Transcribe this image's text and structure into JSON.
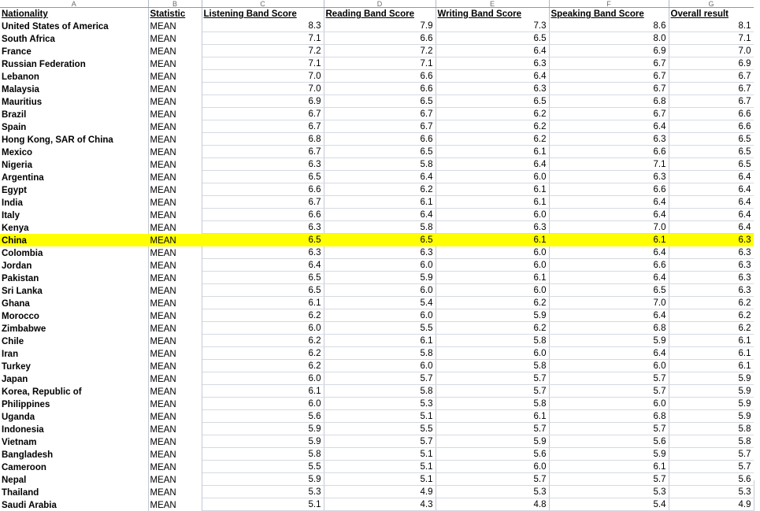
{
  "app": {
    "type": "spreadsheet",
    "highlight_color": "#ffff00",
    "grid_line_color": "#c3c9d3"
  },
  "column_letters": [
    "A",
    "B",
    "C",
    "D",
    "E",
    "F",
    "G"
  ],
  "table": {
    "headers": [
      "Nationality",
      "Statistic",
      "Listening Band Score",
      "Reading Band Score",
      "Writing Band Score",
      "Speaking Band Score",
      "Overall result"
    ],
    "highlighted_row_index": 17,
    "rows": [
      {
        "nationality": "United States of America",
        "statistic": "MEAN",
        "listening": "8.3",
        "reading": "7.9",
        "writing": "7.3",
        "speaking": "8.6",
        "overall": "8.1"
      },
      {
        "nationality": "South Africa",
        "statistic": "MEAN",
        "listening": "7.1",
        "reading": "6.6",
        "writing": "6.5",
        "speaking": "8.0",
        "overall": "7.1"
      },
      {
        "nationality": "France",
        "statistic": "MEAN",
        "listening": "7.2",
        "reading": "7.2",
        "writing": "6.4",
        "speaking": "6.9",
        "overall": "7.0"
      },
      {
        "nationality": "Russian Federation",
        "statistic": "MEAN",
        "listening": "7.1",
        "reading": "7.1",
        "writing": "6.3",
        "speaking": "6.7",
        "overall": "6.9"
      },
      {
        "nationality": "Lebanon",
        "statistic": "MEAN",
        "listening": "7.0",
        "reading": "6.6",
        "writing": "6.4",
        "speaking": "6.7",
        "overall": "6.7"
      },
      {
        "nationality": "Malaysia",
        "statistic": "MEAN",
        "listening": "7.0",
        "reading": "6.6",
        "writing": "6.3",
        "speaking": "6.7",
        "overall": "6.7"
      },
      {
        "nationality": "Mauritius",
        "statistic": "MEAN",
        "listening": "6.9",
        "reading": "6.5",
        "writing": "6.5",
        "speaking": "6.8",
        "overall": "6.7"
      },
      {
        "nationality": "Brazil",
        "statistic": "MEAN",
        "listening": "6.7",
        "reading": "6.7",
        "writing": "6.2",
        "speaking": "6.7",
        "overall": "6.6"
      },
      {
        "nationality": "Spain",
        "statistic": "MEAN",
        "listening": "6.7",
        "reading": "6.7",
        "writing": "6.2",
        "speaking": "6.4",
        "overall": "6.6"
      },
      {
        "nationality": "Hong Kong, SAR of China",
        "statistic": "MEAN",
        "listening": "6.8",
        "reading": "6.6",
        "writing": "6.2",
        "speaking": "6.3",
        "overall": "6.5"
      },
      {
        "nationality": "Mexico",
        "statistic": "MEAN",
        "listening": "6.7",
        "reading": "6.5",
        "writing": "6.1",
        "speaking": "6.6",
        "overall": "6.5"
      },
      {
        "nationality": "Nigeria",
        "statistic": "MEAN",
        "listening": "6.3",
        "reading": "5.8",
        "writing": "6.4",
        "speaking": "7.1",
        "overall": "6.5"
      },
      {
        "nationality": "Argentina",
        "statistic": "MEAN",
        "listening": "6.5",
        "reading": "6.4",
        "writing": "6.0",
        "speaking": "6.3",
        "overall": "6.4"
      },
      {
        "nationality": "Egypt",
        "statistic": "MEAN",
        "listening": "6.6",
        "reading": "6.2",
        "writing": "6.1",
        "speaking": "6.6",
        "overall": "6.4"
      },
      {
        "nationality": "India",
        "statistic": "MEAN",
        "listening": "6.7",
        "reading": "6.1",
        "writing": "6.1",
        "speaking": "6.4",
        "overall": "6.4"
      },
      {
        "nationality": "Italy",
        "statistic": "MEAN",
        "listening": "6.6",
        "reading": "6.4",
        "writing": "6.0",
        "speaking": "6.4",
        "overall": "6.4"
      },
      {
        "nationality": "Kenya",
        "statistic": "MEAN",
        "listening": "6.3",
        "reading": "5.8",
        "writing": "6.3",
        "speaking": "7.0",
        "overall": "6.4"
      },
      {
        "nationality": "China",
        "statistic": "MEAN",
        "listening": "6.5",
        "reading": "6.5",
        "writing": "6.1",
        "speaking": "6.1",
        "overall": "6.3"
      },
      {
        "nationality": "Colombia",
        "statistic": "MEAN",
        "listening": "6.3",
        "reading": "6.3",
        "writing": "6.0",
        "speaking": "6.4",
        "overall": "6.3"
      },
      {
        "nationality": "Jordan",
        "statistic": "MEAN",
        "listening": "6.4",
        "reading": "6.0",
        "writing": "6.0",
        "speaking": "6.6",
        "overall": "6.3"
      },
      {
        "nationality": "Pakistan",
        "statistic": "MEAN",
        "listening": "6.5",
        "reading": "5.9",
        "writing": "6.1",
        "speaking": "6.4",
        "overall": "6.3"
      },
      {
        "nationality": "Sri Lanka",
        "statistic": "MEAN",
        "listening": "6.5",
        "reading": "6.0",
        "writing": "6.0",
        "speaking": "6.5",
        "overall": "6.3"
      },
      {
        "nationality": "Ghana",
        "statistic": "MEAN",
        "listening": "6.1",
        "reading": "5.4",
        "writing": "6.2",
        "speaking": "7.0",
        "overall": "6.2"
      },
      {
        "nationality": "Morocco",
        "statistic": "MEAN",
        "listening": "6.2",
        "reading": "6.0",
        "writing": "5.9",
        "speaking": "6.4",
        "overall": "6.2"
      },
      {
        "nationality": "Zimbabwe",
        "statistic": "MEAN",
        "listening": "6.0",
        "reading": "5.5",
        "writing": "6.2",
        "speaking": "6.8",
        "overall": "6.2"
      },
      {
        "nationality": "Chile",
        "statistic": "MEAN",
        "listening": "6.2",
        "reading": "6.1",
        "writing": "5.8",
        "speaking": "5.9",
        "overall": "6.1"
      },
      {
        "nationality": "Iran",
        "statistic": "MEAN",
        "listening": "6.2",
        "reading": "5.8",
        "writing": "6.0",
        "speaking": "6.4",
        "overall": "6.1"
      },
      {
        "nationality": "Turkey",
        "statistic": "MEAN",
        "listening": "6.2",
        "reading": "6.0",
        "writing": "5.8",
        "speaking": "6.0",
        "overall": "6.1"
      },
      {
        "nationality": "Japan",
        "statistic": "MEAN",
        "listening": "6.0",
        "reading": "5.7",
        "writing": "5.7",
        "speaking": "5.7",
        "overall": "5.9"
      },
      {
        "nationality": "Korea, Republic of",
        "statistic": "MEAN",
        "listening": "6.1",
        "reading": "5.8",
        "writing": "5.7",
        "speaking": "5.7",
        "overall": "5.9"
      },
      {
        "nationality": "Philippines",
        "statistic": "MEAN",
        "listening": "6.0",
        "reading": "5.3",
        "writing": "5.8",
        "speaking": "6.0",
        "overall": "5.9"
      },
      {
        "nationality": "Uganda",
        "statistic": "MEAN",
        "listening": "5.6",
        "reading": "5.1",
        "writing": "6.1",
        "speaking": "6.8",
        "overall": "5.9"
      },
      {
        "nationality": "Indonesia",
        "statistic": "MEAN",
        "listening": "5.9",
        "reading": "5.5",
        "writing": "5.7",
        "speaking": "5.7",
        "overall": "5.8"
      },
      {
        "nationality": "Vietnam",
        "statistic": "MEAN",
        "listening": "5.9",
        "reading": "5.7",
        "writing": "5.9",
        "speaking": "5.6",
        "overall": "5.8"
      },
      {
        "nationality": "Bangladesh",
        "statistic": "MEAN",
        "listening": "5.8",
        "reading": "5.1",
        "writing": "5.6",
        "speaking": "5.9",
        "overall": "5.7"
      },
      {
        "nationality": "Cameroon",
        "statistic": "MEAN",
        "listening": "5.5",
        "reading": "5.1",
        "writing": "6.0",
        "speaking": "6.1",
        "overall": "5.7"
      },
      {
        "nationality": "Nepal",
        "statistic": "MEAN",
        "listening": "5.9",
        "reading": "5.1",
        "writing": "5.7",
        "speaking": "5.7",
        "overall": "5.6"
      },
      {
        "nationality": "Thailand",
        "statistic": "MEAN",
        "listening": "5.3",
        "reading": "4.9",
        "writing": "5.3",
        "speaking": "5.3",
        "overall": "5.3"
      },
      {
        "nationality": "Saudi Arabia",
        "statistic": "MEAN",
        "listening": "5.1",
        "reading": "4.3",
        "writing": "4.8",
        "speaking": "5.4",
        "overall": "4.9"
      }
    ]
  }
}
